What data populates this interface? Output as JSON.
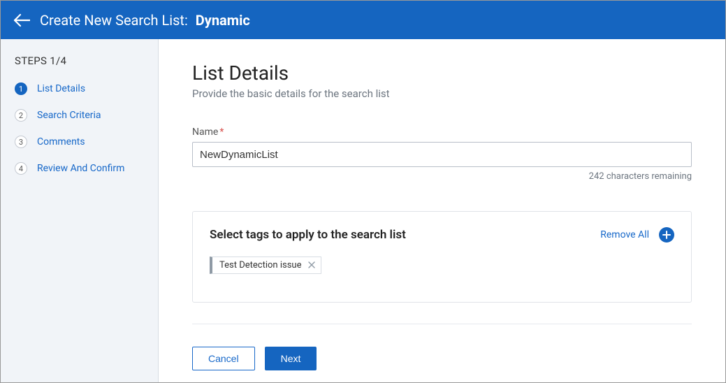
{
  "header": {
    "title_prefix": "Create New Search List:",
    "title_type": "Dynamic"
  },
  "sidebar": {
    "steps_label": "STEPS 1/4",
    "steps": [
      {
        "num": "1",
        "label": "List Details",
        "active": true
      },
      {
        "num": "2",
        "label": "Search Criteria",
        "active": false
      },
      {
        "num": "3",
        "label": "Comments",
        "active": false
      },
      {
        "num": "4",
        "label": "Review And Confirm",
        "active": false
      }
    ]
  },
  "main": {
    "title": "List Details",
    "subtitle": "Provide the basic details for the search list",
    "name_label": "Name",
    "name_value": "NewDynamicList",
    "char_remaining": "242 characters remaining",
    "tags_title": "Select tags to apply to the search list",
    "remove_all_label": "Remove All",
    "tags": [
      {
        "label": "Test Detection issue"
      }
    ]
  },
  "footer": {
    "cancel_label": "Cancel",
    "next_label": "Next"
  }
}
